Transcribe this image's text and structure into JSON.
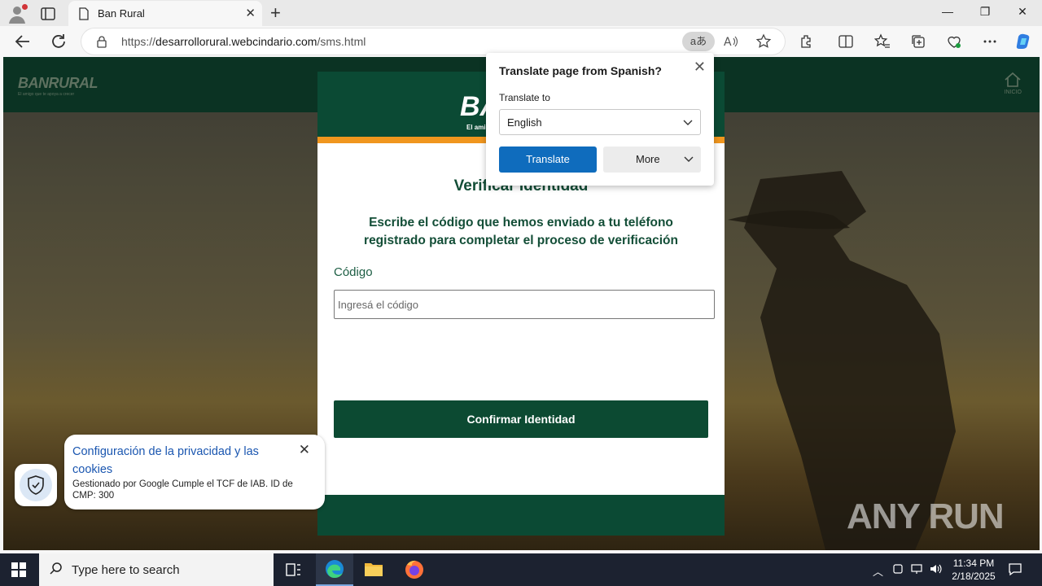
{
  "browser": {
    "tab_title": "Ban Rural",
    "url_prefix": "https://",
    "url_domain": "desarrollorural.webcindario.com",
    "url_path": "/sms.html",
    "translate_pill": "aあ"
  },
  "page": {
    "bg_logo": "BANRURAL",
    "bg_logo_tagline": "El amigo que te apoya a crecer",
    "home_label": "INICIO",
    "card_logo": "BA",
    "card_logo_tagline": "El amigo",
    "title": "Verificar Identidad",
    "instructions": "Escribe el código que hemos enviado a tu teléfono registrado para completar el proceso de verificación",
    "code_label": "Código",
    "code_placeholder": "Ingresá el código",
    "confirm_button": "Confirmar Identidad"
  },
  "cookie_banner": {
    "title": "Configuración de la privacidad y las cookies",
    "text": "Gestionado por Google Cumple el TCF de IAB. ID de CMP: 300"
  },
  "translate_popup": {
    "title": "Translate page from Spanish?",
    "translate_to_label": "Translate to",
    "selected_language": "English",
    "translate_button": "Translate",
    "more_button": "More"
  },
  "watermark": "ANY RUN",
  "taskbar": {
    "search_placeholder": "Type here to search",
    "time": "11:34 PM",
    "date": "2/18/2025"
  }
}
